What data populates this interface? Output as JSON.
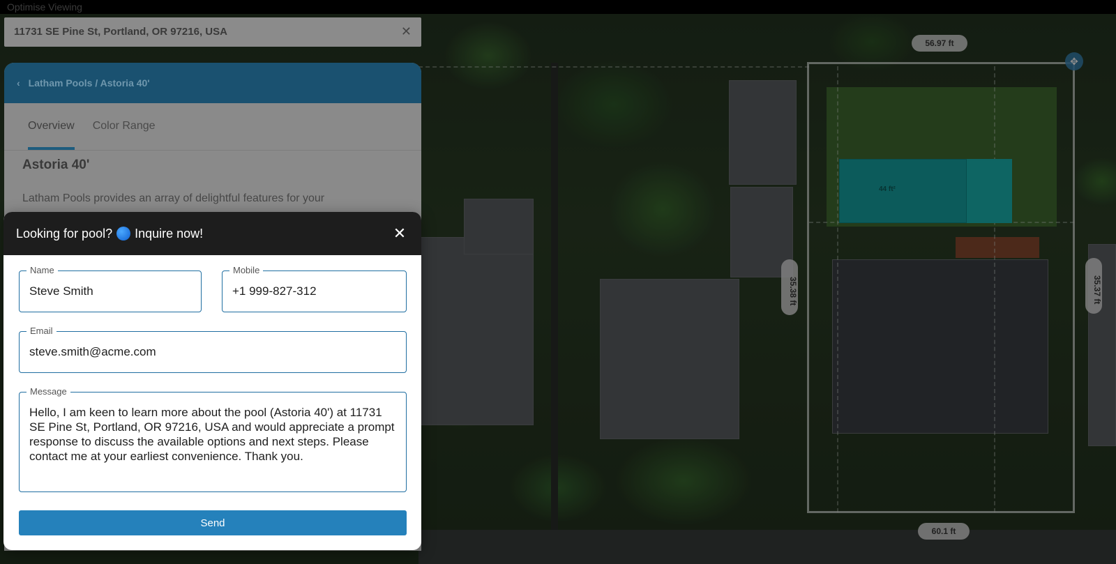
{
  "topbar": {
    "title": "Optimise Viewing"
  },
  "search": {
    "address": "11731 SE Pine St, Portland, OR 97216, USA",
    "clear_icon": "close-icon"
  },
  "panel": {
    "breadcrumb": "Latham Pools / Astoria 40'",
    "tabs": [
      {
        "label": "Overview"
      },
      {
        "label": "Color Range"
      }
    ],
    "title": "Astoria 40'",
    "description": "Latham Pools provides an array of delightful features for your"
  },
  "map": {
    "top_measure": "56.97 ft",
    "bottom_measure": "60.1 ft",
    "left_measure": "35.38 ft",
    "right_measure": "35.37 ft",
    "pool_area": "44 ft²"
  },
  "dialog": {
    "title_prefix": "Looking for pool?",
    "title_suffix": "Inquire now!",
    "name_label": "Name",
    "name_value": "Steve Smith",
    "mobile_label": "Mobile",
    "mobile_value": "+1 999-827-312",
    "email_label": "Email",
    "email_value": "steve.smith@acme.com",
    "message_label": "Message",
    "message_value": "Hello, I am keen to learn more about the pool (Astoria 40') at 11731 SE Pine St, Portland, OR 97216, USA and would appreciate a prompt response to discuss the available options and next steps. Please contact me at your earliest convenience. Thank you.",
    "send_label": "Send"
  },
  "colors": {
    "accent": "#2581bb",
    "pool": "#16a7a7",
    "dialog_header": "#1d1d1d"
  }
}
